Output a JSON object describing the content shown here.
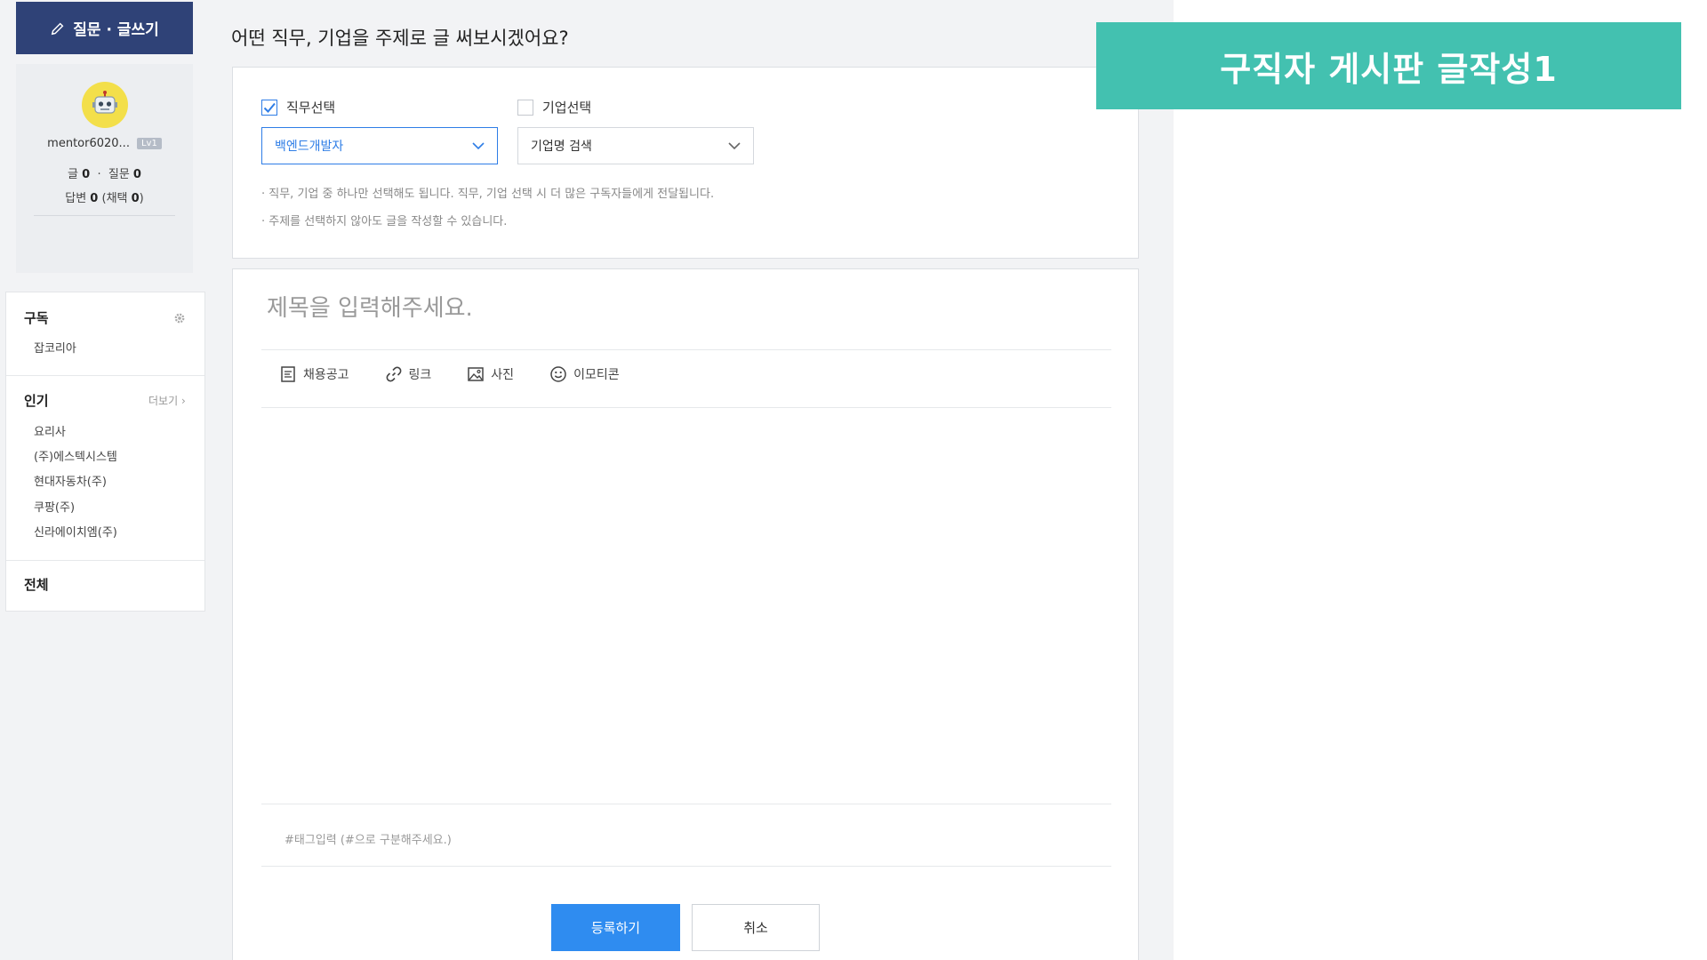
{
  "sidebar": {
    "write_button_label": "질문 · 글쓰기",
    "profile": {
      "username": "mentor6020...",
      "level": "Lv1",
      "posts_label": "글",
      "posts": "0",
      "questions_label": "질문",
      "questions": "0",
      "answers_label": "답변",
      "answers": "0",
      "adopted_label": "채택",
      "adopted": "0"
    },
    "subscribe": {
      "title": "구독",
      "items": [
        "잡코리아"
      ]
    },
    "popular": {
      "title": "인기",
      "more_label": "더보기",
      "items": [
        "요리사",
        "(주)에스텍시스템",
        "현대자동차(주)",
        "쿠팡(주)",
        "신라에이치엠(주)"
      ]
    },
    "all": {
      "title": "전체"
    }
  },
  "main": {
    "title": "어떤 직무, 기업을 주제로 글 써보시겠어요?",
    "job_checkbox_label": "직무선택",
    "job_checked": true,
    "company_checkbox_label": "기업선택",
    "company_checked": false,
    "job_select_value": "백엔드개발자",
    "company_select_value": "기업명 검색",
    "note1": "· 직무, 기업 중 하나만 선택해도 됩니다. 직무, 기업 선택 시 더 많은 구독자들에게 전달됩니다.",
    "note2": "· 주제를 선택하지 않아도 글을 작성할 수 있습니다.",
    "title_placeholder": "제목을 입력해주세요.",
    "toolbar": {
      "job_posting": "채용공고",
      "link": "링크",
      "photo": "사진",
      "emoticon": "이모티콘"
    },
    "tag_placeholder": "#태그입력 (#으로 구분해주세요.)",
    "submit_label": "등록하기",
    "cancel_label": "취소"
  },
  "banner": {
    "text": "구직자 게시판 글작성1"
  },
  "colors": {
    "primary_navy": "#2f4277",
    "accent_blue": "#2f8cf0",
    "banner_teal": "#43c1b0",
    "avatar_yellow": "#f3df4a"
  },
  "icons": [
    "pencil-icon",
    "robot-avatar-icon",
    "gear-icon",
    "chevron-down-icon",
    "document-icon",
    "link-icon",
    "image-icon",
    "smiley-icon",
    "checkmark-icon"
  ]
}
